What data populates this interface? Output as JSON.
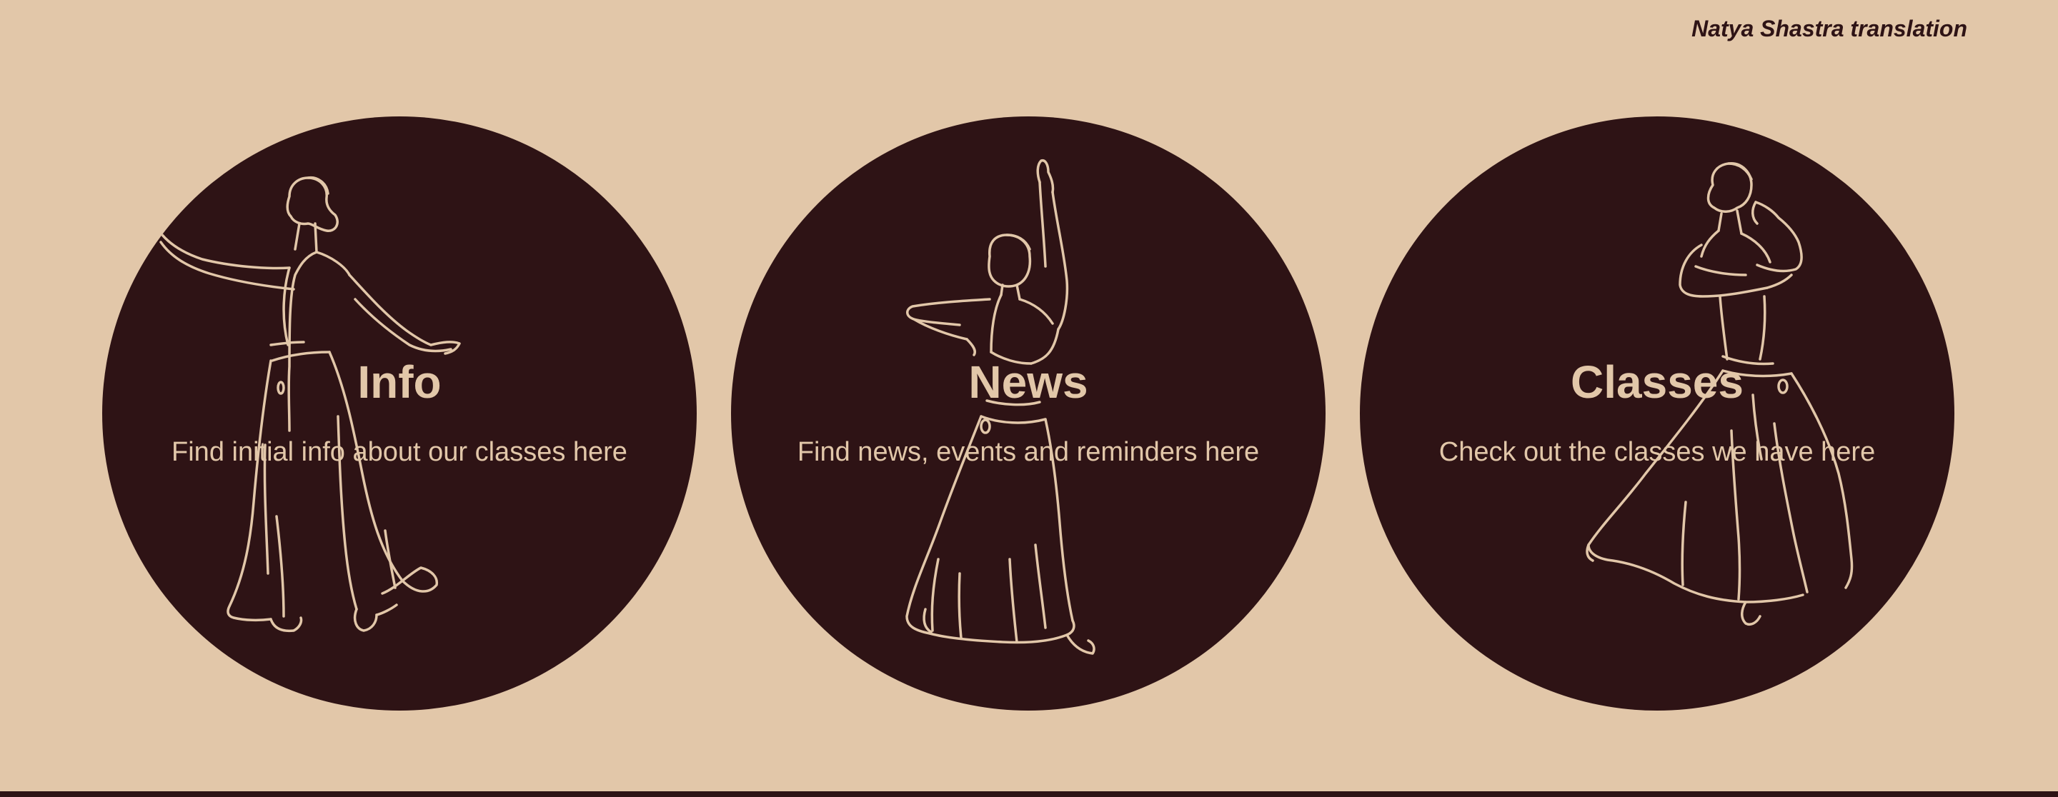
{
  "header": {
    "link_label": "Natya Shastra translation"
  },
  "cards": [
    {
      "id": "info",
      "title": "Info",
      "description": "Find initial info about our classes here",
      "illustration": "dancer-arms-extended-illustration"
    },
    {
      "id": "news",
      "title": "News",
      "description": "Find news, events and reminders here",
      "illustration": "dancer-arm-raised-illustration"
    },
    {
      "id": "classes",
      "title": "Classes",
      "description": "Check out the classes we have here",
      "illustration": "dancer-turning-illustration"
    }
  ],
  "colors": {
    "background": "#e2c7a9",
    "card": "#2e1315",
    "text_light": "#e2c7a9",
    "text_dark": "#2e1315"
  }
}
